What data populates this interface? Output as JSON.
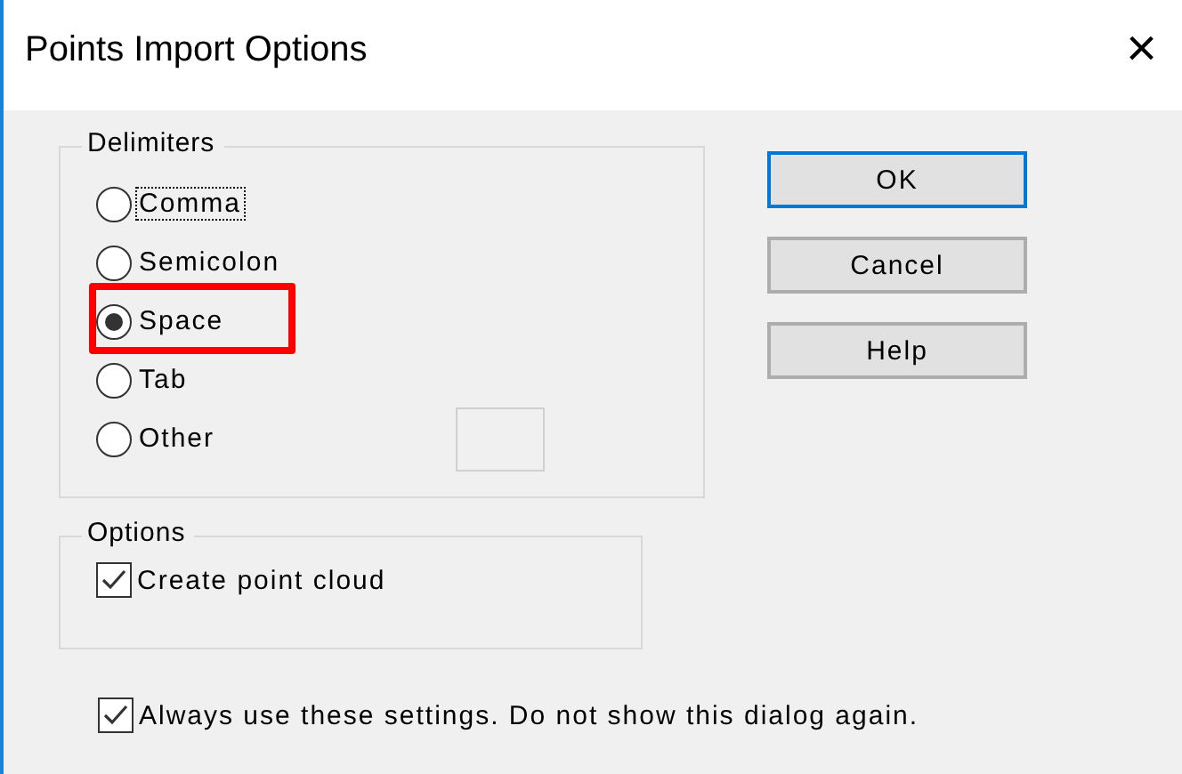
{
  "window": {
    "title": "Points Import Options",
    "close": "×"
  },
  "delimiters": {
    "title": "Delimiters",
    "items": [
      {
        "label": "Comma",
        "kind": "plain",
        "selected": false,
        "focused": true,
        "highlighted": false
      },
      {
        "label": "Semicolon",
        "kind": "plain",
        "selected": false,
        "focused": false,
        "highlighted": false
      },
      {
        "label": "Space",
        "kind": "plain",
        "selected": true,
        "focused": false,
        "highlighted": true
      },
      {
        "label": "Tab",
        "kind": "plain",
        "selected": false,
        "focused": false,
        "highlighted": false
      },
      {
        "label": "Other",
        "kind": "with-field",
        "selected": false,
        "focused": false,
        "highlighted": false
      }
    ]
  },
  "buttons": [
    {
      "label": "OK",
      "default": true
    },
    {
      "label": "Cancel",
      "default": false
    },
    {
      "label": "Help",
      "default": false
    }
  ],
  "options": {
    "title": "Options",
    "items": [
      {
        "label": "Create point cloud",
        "checked": true
      }
    ]
  },
  "always": {
    "label": "Always use these settings. Do not show this dialog again.",
    "checked": true
  }
}
